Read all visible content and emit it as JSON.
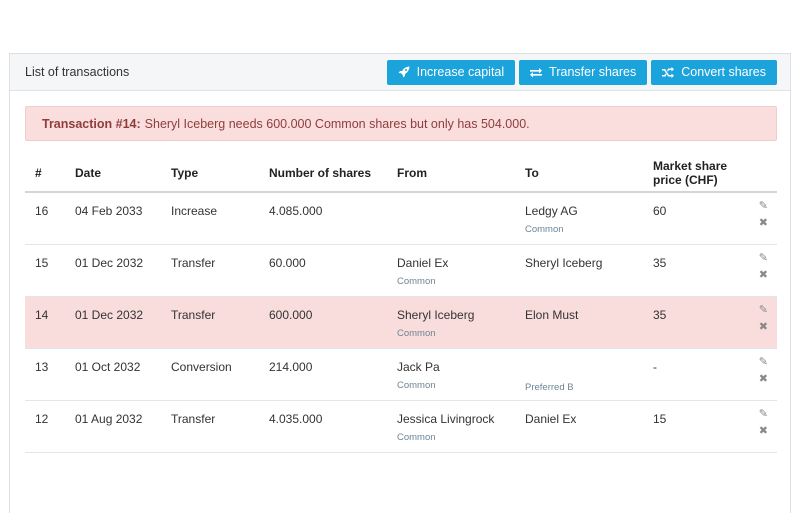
{
  "panel": {
    "title": "List of transactions",
    "buttons": [
      {
        "label": "Increase capital",
        "icon": "rocket-icon"
      },
      {
        "label": "Transfer shares",
        "icon": "exchange-icon"
      },
      {
        "label": "Convert shares",
        "icon": "shuffle-icon"
      }
    ]
  },
  "alert": {
    "prefix": "Transaction #14:",
    "message": "Sheryl Iceberg needs 600.000 Common shares but only has 504.000."
  },
  "table": {
    "headers": [
      "#",
      "Date",
      "Type",
      "Number of shares",
      "From",
      "To",
      "Market share price (CHF)"
    ],
    "rows": [
      {
        "num": "16",
        "date": "04 Feb 2033",
        "type": "Increase",
        "shares": "4.085.000",
        "from": "",
        "from_class": "",
        "to": "Ledgy AG",
        "to_class": "Common",
        "price": "60",
        "highlight": false
      },
      {
        "num": "15",
        "date": "01 Dec 2032",
        "type": "Transfer",
        "shares": "60.000",
        "from": "Daniel Ex",
        "from_class": "Common",
        "to": "Sheryl Iceberg",
        "to_class": "",
        "price": "35",
        "highlight": false
      },
      {
        "num": "14",
        "date": "01 Dec 2032",
        "type": "Transfer",
        "shares": "600.000",
        "from": "Sheryl Iceberg",
        "from_class": "Common",
        "to": "Elon Must",
        "to_class": "",
        "price": "35",
        "highlight": true
      },
      {
        "num": "13",
        "date": "01 Oct 2032",
        "type": "Conversion",
        "shares": "214.000",
        "from": "Jack Pa",
        "from_class": "Common",
        "to": "",
        "to_class": "Preferred B",
        "price": "-",
        "highlight": false
      },
      {
        "num": "12",
        "date": "01 Aug 2032",
        "type": "Transfer",
        "shares": "4.035.000",
        "from": "Jessica Livingrock",
        "from_class": "Common",
        "to": "Daniel Ex",
        "to_class": "",
        "price": "15",
        "highlight": false
      }
    ]
  },
  "colors": {
    "button": "#1ba3dc",
    "alert_bg": "#f9dedd",
    "alert_text": "#8f3d3c",
    "highlight_row": "#f9dcdc"
  }
}
